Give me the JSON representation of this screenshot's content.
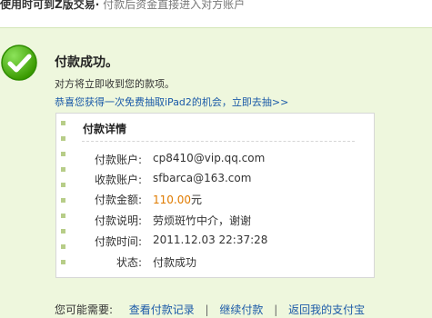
{
  "top": {
    "left_text": "使用时可到Z版交易·",
    "right_text": "付款后资金直接进入对方账户"
  },
  "success": {
    "title": "付款成功。",
    "subtitle": "对方将立即收到您的款项。",
    "promo_link": "恭喜您获得一次免费抽取iPad2的机会，立即去抽>>"
  },
  "details": {
    "heading": "付款详情",
    "rows": [
      {
        "label": "付款账户:",
        "value": "cp8410@vip.qq.com"
      },
      {
        "label": "收款账户:",
        "value": "sfbarca@163.com"
      },
      {
        "label": "付款金额:",
        "value": "110.00",
        "suffix": "元"
      },
      {
        "label": "付款说明:",
        "value": "劳烦斑竹中介，谢谢"
      },
      {
        "label": "付款时间:",
        "value": "2011.12.03 22:37:28"
      },
      {
        "label": "状态:",
        "value": "付款成功"
      }
    ]
  },
  "bottom": {
    "lead": "您可能需要:",
    "links": [
      "查看付款记录",
      "继续付款",
      "返回我的支付宝"
    ]
  },
  "colors": {
    "panel_bg": "#eef7dd",
    "link": "#1b5aa8",
    "amount": "#e07b00",
    "success": "#42a000"
  }
}
